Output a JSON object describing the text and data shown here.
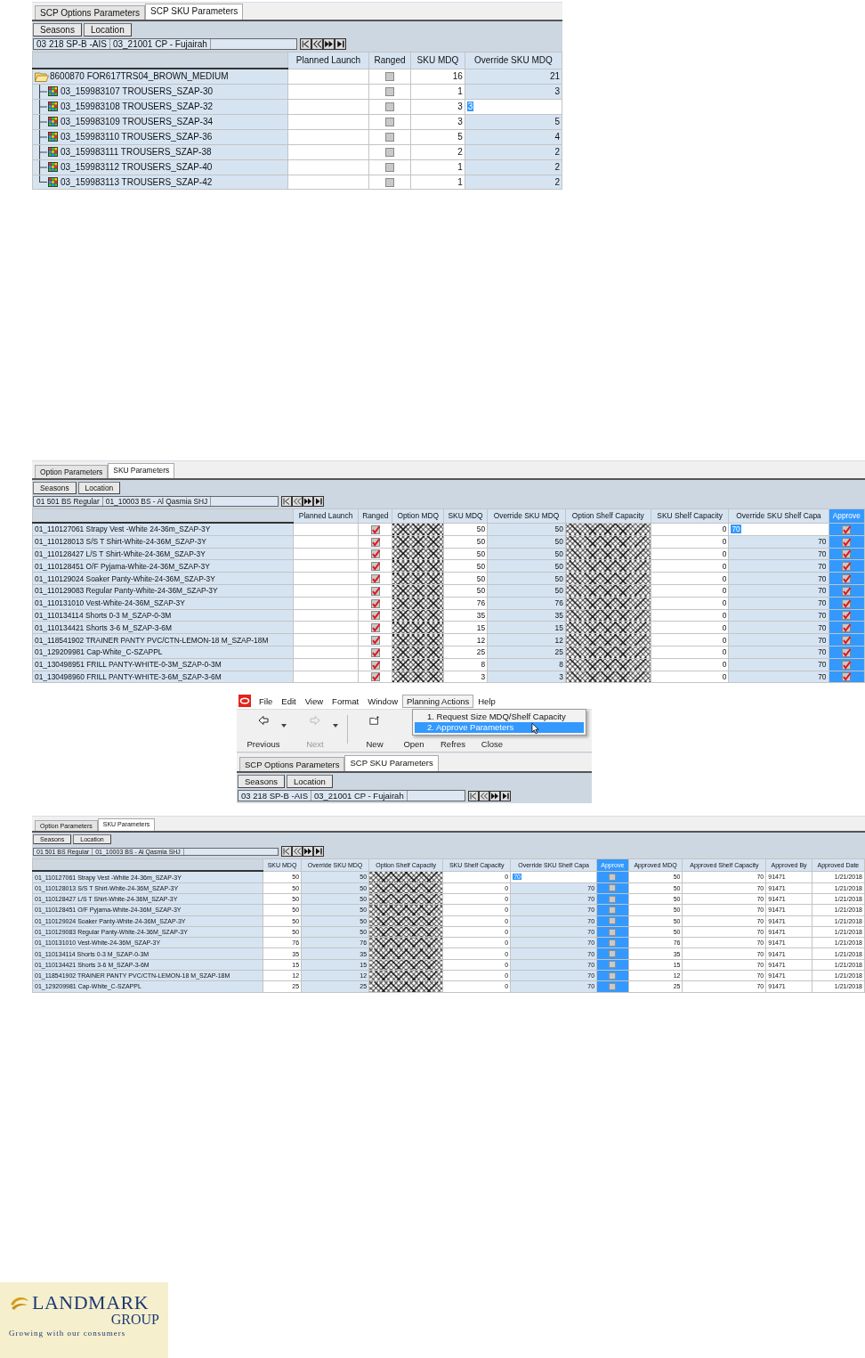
{
  "panels": [
    {
      "kind": "grid",
      "tabs": [
        {
          "label": "SCP Options Parameters",
          "selected": false
        },
        {
          "label": "SCP SKU Parameters",
          "selected": true
        }
      ],
      "buttons": [
        "Seasons",
        "Location"
      ],
      "context": [
        "03  218  SP-B -AIS",
        "03_21001 CP - Fujairah"
      ],
      "columns": [
        {
          "label": "Planned Launch",
          "selected": false
        },
        {
          "label": "Ranged",
          "selected": false
        },
        {
          "label": "SKU MDQ",
          "selected": false
        },
        {
          "label": "Override SKU MDQ",
          "selected": false
        }
      ],
      "rows": [
        {
          "label": "8600870 FOR617TRS04_BROWN_MEDIUM",
          "cells": [
            {
              "kind": "blank"
            },
            {
              "kind": "check",
              "checked": false
            },
            {
              "kind": "num",
              "text": "16"
            },
            {
              "kind": "input",
              "text": "21"
            }
          ],
          "children": [
            {
              "label": "03_159983107 TROUSERS_SZAP-30",
              "cells": [
                {
                  "kind": "blank"
                },
                {
                  "kind": "check",
                  "checked": false
                },
                {
                  "kind": "num",
                  "text": "1"
                },
                {
                  "kind": "input",
                  "text": "3"
                }
              ]
            },
            {
              "label": "03_159983108 TROUSERS_SZAP-32",
              "cells": [
                {
                  "kind": "blank"
                },
                {
                  "kind": "check",
                  "checked": false
                },
                {
                  "kind": "num",
                  "text": "3"
                },
                {
                  "kind": "edit",
                  "text": "3"
                }
              ]
            },
            {
              "label": "03_159983109 TROUSERS_SZAP-34",
              "cells": [
                {
                  "kind": "blank"
                },
                {
                  "kind": "check",
                  "checked": false
                },
                {
                  "kind": "num",
                  "text": "3"
                },
                {
                  "kind": "input",
                  "text": "5"
                }
              ]
            },
            {
              "label": "03_159983110 TROUSERS_SZAP-36",
              "cells": [
                {
                  "kind": "blank"
                },
                {
                  "kind": "check",
                  "checked": false
                },
                {
                  "kind": "num",
                  "text": "5"
                },
                {
                  "kind": "input",
                  "text": "4"
                }
              ]
            },
            {
              "label": "03_159983111 TROUSERS_SZAP-38",
              "cells": [
                {
                  "kind": "blank"
                },
                {
                  "kind": "check",
                  "checked": false
                },
                {
                  "kind": "num",
                  "text": "2"
                },
                {
                  "kind": "input",
                  "text": "2"
                }
              ]
            },
            {
              "label": "03_159983112 TROUSERS_SZAP-40",
              "cells": [
                {
                  "kind": "blank"
                },
                {
                  "kind": "check",
                  "checked": false
                },
                {
                  "kind": "num",
                  "text": "1"
                },
                {
                  "kind": "input",
                  "text": "2"
                }
              ]
            },
            {
              "label": "03_159983113 TROUSERS_SZAP-42",
              "cells": [
                {
                  "kind": "blank"
                },
                {
                  "kind": "check",
                  "checked": false
                },
                {
                  "kind": "num",
                  "text": "1"
                },
                {
                  "kind": "input",
                  "text": "2"
                }
              ]
            }
          ]
        }
      ]
    },
    {
      "kind": "grid",
      "tabs": [
        {
          "label": "Option Parameters",
          "selected": false
        },
        {
          "label": "SKU Parameters",
          "selected": true
        }
      ],
      "buttons": [
        "Seasons",
        "Location"
      ],
      "context": [
        "01  501  BS Regular",
        "01_10003 BS - Al Qasmia SHJ"
      ],
      "columns": [
        {
          "label": "Planned Launch",
          "selected": false
        },
        {
          "label": "Ranged",
          "selected": false
        },
        {
          "label": "Option MDQ",
          "selected": false
        },
        {
          "label": "SKU MDQ",
          "selected": false
        },
        {
          "label": "Override SKU MDQ",
          "selected": false
        },
        {
          "label": "Option Shelf Capacity",
          "selected": false
        },
        {
          "label": "SKU Shelf Capacity",
          "selected": false
        },
        {
          "label": "Override SKU Shelf Capa",
          "selected": false
        },
        {
          "label": "Approve",
          "selected": true
        }
      ],
      "rows": [
        {
          "label": "01_110127061 Strapy Vest -White 24-36m_SZAP-3Y",
          "cells": [
            {
              "kind": "blank"
            },
            {
              "kind": "check",
              "checked": true
            },
            {
              "kind": "hatch"
            },
            {
              "kind": "num",
              "text": "50"
            },
            {
              "kind": "input",
              "text": "50"
            },
            {
              "kind": "hatch"
            },
            {
              "kind": "num",
              "text": "0"
            },
            {
              "kind": "edit",
              "text": "70"
            },
            {
              "kind": "check",
              "checked": true
            }
          ]
        },
        {
          "label": "01_110128013 S/S T Shirt-White-24-36M_SZAP-3Y",
          "cells": [
            {
              "kind": "blank"
            },
            {
              "kind": "check",
              "checked": true
            },
            {
              "kind": "hatch"
            },
            {
              "kind": "num",
              "text": "50"
            },
            {
              "kind": "input",
              "text": "50"
            },
            {
              "kind": "hatch"
            },
            {
              "kind": "num",
              "text": "0"
            },
            {
              "kind": "input",
              "text": "70"
            },
            {
              "kind": "check",
              "checked": true
            }
          ]
        },
        {
          "label": "01_110128427 L/S T Shirt-White-24-36M_SZAP-3Y",
          "cells": [
            {
              "kind": "blank"
            },
            {
              "kind": "check",
              "checked": true
            },
            {
              "kind": "hatch"
            },
            {
              "kind": "num",
              "text": "50"
            },
            {
              "kind": "input",
              "text": "50"
            },
            {
              "kind": "hatch"
            },
            {
              "kind": "num",
              "text": "0"
            },
            {
              "kind": "input",
              "text": "70"
            },
            {
              "kind": "check",
              "checked": true
            }
          ]
        },
        {
          "label": "01_110128451 O/F Pyjama-White-24-36M_SZAP-3Y",
          "cells": [
            {
              "kind": "blank"
            },
            {
              "kind": "check",
              "checked": true
            },
            {
              "kind": "hatch"
            },
            {
              "kind": "num",
              "text": "50"
            },
            {
              "kind": "input",
              "text": "50"
            },
            {
              "kind": "hatch"
            },
            {
              "kind": "num",
              "text": "0"
            },
            {
              "kind": "input",
              "text": "70"
            },
            {
              "kind": "check",
              "checked": true
            }
          ]
        },
        {
          "label": "01_110129024 Soaker Panty-White-24-36M_SZAP-3Y",
          "cells": [
            {
              "kind": "blank"
            },
            {
              "kind": "check",
              "checked": true
            },
            {
              "kind": "hatch"
            },
            {
              "kind": "num",
              "text": "50"
            },
            {
              "kind": "input",
              "text": "50"
            },
            {
              "kind": "hatch"
            },
            {
              "kind": "num",
              "text": "0"
            },
            {
              "kind": "input",
              "text": "70"
            },
            {
              "kind": "check",
              "checked": true
            }
          ]
        },
        {
          "label": "01_110129083 Regular Panty-White-24-36M_SZAP-3Y",
          "cells": [
            {
              "kind": "blank"
            },
            {
              "kind": "check",
              "checked": true
            },
            {
              "kind": "hatch"
            },
            {
              "kind": "num",
              "text": "50"
            },
            {
              "kind": "input",
              "text": "50"
            },
            {
              "kind": "hatch"
            },
            {
              "kind": "num",
              "text": "0"
            },
            {
              "kind": "input",
              "text": "70"
            },
            {
              "kind": "check",
              "checked": true
            }
          ]
        },
        {
          "label": "01_110131010 Vest-White-24-36M_SZAP-3Y",
          "cells": [
            {
              "kind": "blank"
            },
            {
              "kind": "check",
              "checked": true
            },
            {
              "kind": "hatch"
            },
            {
              "kind": "num",
              "text": "76"
            },
            {
              "kind": "input",
              "text": "76"
            },
            {
              "kind": "hatch"
            },
            {
              "kind": "num",
              "text": "0"
            },
            {
              "kind": "input",
              "text": "70"
            },
            {
              "kind": "check",
              "checked": true
            }
          ]
        },
        {
          "label": "01_110134114 Shorts 0-3 M_SZAP-0-3M",
          "cells": [
            {
              "kind": "blank"
            },
            {
              "kind": "check",
              "checked": true
            },
            {
              "kind": "hatch"
            },
            {
              "kind": "num",
              "text": "35"
            },
            {
              "kind": "input",
              "text": "35"
            },
            {
              "kind": "hatch"
            },
            {
              "kind": "num",
              "text": "0"
            },
            {
              "kind": "input",
              "text": "70"
            },
            {
              "kind": "check",
              "checked": true
            }
          ]
        },
        {
          "label": "01_110134421 Shorts 3-6 M_SZAP-3-6M",
          "cells": [
            {
              "kind": "blank"
            },
            {
              "kind": "check",
              "checked": true
            },
            {
              "kind": "hatch"
            },
            {
              "kind": "num",
              "text": "15"
            },
            {
              "kind": "input",
              "text": "15"
            },
            {
              "kind": "hatch"
            },
            {
              "kind": "num",
              "text": "0"
            },
            {
              "kind": "input",
              "text": "70"
            },
            {
              "kind": "check",
              "checked": true
            }
          ]
        },
        {
          "label": "01_118541902 TRAINER PANTY PVC/CTN-LEMON-18 M_SZAP-18M",
          "cells": [
            {
              "kind": "blank"
            },
            {
              "kind": "check",
              "checked": true
            },
            {
              "kind": "hatch"
            },
            {
              "kind": "num",
              "text": "12"
            },
            {
              "kind": "input",
              "text": "12"
            },
            {
              "kind": "hatch"
            },
            {
              "kind": "num",
              "text": "0"
            },
            {
              "kind": "input",
              "text": "70"
            },
            {
              "kind": "check",
              "checked": true
            }
          ]
        },
        {
          "label": "01_129209981 Cap-White_C-SZAPPL",
          "cells": [
            {
              "kind": "blank"
            },
            {
              "kind": "check",
              "checked": true
            },
            {
              "kind": "hatch"
            },
            {
              "kind": "num",
              "text": "25"
            },
            {
              "kind": "input",
              "text": "25"
            },
            {
              "kind": "hatch"
            },
            {
              "kind": "num",
              "text": "0"
            },
            {
              "kind": "input",
              "text": "70"
            },
            {
              "kind": "check",
              "checked": true
            }
          ]
        },
        {
          "label": "01_130498951 FRILL PANTY-WHITE-0-3M_SZAP-0-3M",
          "cells": [
            {
              "kind": "blank"
            },
            {
              "kind": "check",
              "checked": true
            },
            {
              "kind": "hatch"
            },
            {
              "kind": "num",
              "text": "8"
            },
            {
              "kind": "input",
              "text": "8"
            },
            {
              "kind": "hatch"
            },
            {
              "kind": "num",
              "text": "0"
            },
            {
              "kind": "input",
              "text": "70"
            },
            {
              "kind": "check",
              "checked": true
            }
          ]
        },
        {
          "label": "01_130498960 FRILL PANTY-WHITE-3-6M_SZAP-3-6M",
          "cells": [
            {
              "kind": "blank"
            },
            {
              "kind": "check",
              "checked": true
            },
            {
              "kind": "hatch"
            },
            {
              "kind": "num",
              "text": "3"
            },
            {
              "kind": "input",
              "text": "3"
            },
            {
              "kind": "hatch"
            },
            {
              "kind": "num",
              "text": "0"
            },
            {
              "kind": "input",
              "text": "70"
            },
            {
              "kind": "check",
              "checked": true
            }
          ]
        }
      ]
    },
    {
      "kind": "menu_shot",
      "menubar": [
        {
          "label": "File",
          "selected": false
        },
        {
          "label": "Edit",
          "selected": false
        },
        {
          "label": "View",
          "selected": false
        },
        {
          "label": "Format",
          "selected": false
        },
        {
          "label": "Window",
          "selected": false
        },
        {
          "label": "Planning Actions",
          "selected": true
        },
        {
          "label": "Help",
          "selected": false
        }
      ],
      "dropdown": [
        {
          "label": "1. Request Size MDQ/Shelf Capacity",
          "selected": false
        },
        {
          "label": "2. Approve Parameters",
          "selected": true
        }
      ],
      "toolbar": [
        {
          "label": "Previous",
          "disabled": false,
          "dropdown": true
        },
        {
          "label": "Next",
          "disabled": true,
          "dropdown": true
        },
        {
          "label": "New",
          "disabled": false,
          "dropdown": false
        },
        {
          "label": "Open",
          "disabled": false,
          "dropdown": false
        },
        {
          "label": "Refres",
          "disabled": false,
          "dropdown": false
        },
        {
          "label": "Close",
          "disabled": false,
          "dropdown": false
        }
      ],
      "tabs": [
        {
          "label": "SCP Options Parameters",
          "selected": false
        },
        {
          "label": "SCP SKU Parameters",
          "selected": true
        }
      ],
      "buttons": [
        "Seasons",
        "Location"
      ],
      "context": [
        "03  218  SP-B -AIS",
        "03_21001 CP - Fujairah"
      ]
    },
    {
      "kind": "grid",
      "tabs": [
        {
          "label": "Option Parameters",
          "selected": false
        },
        {
          "label": "SKU Parameters",
          "selected": true
        }
      ],
      "buttons": [
        "Seasons",
        "Location"
      ],
      "context": [
        "01  501  BS Regular",
        "01_10003 BS - Al Qasmia SHJ"
      ],
      "columns": [
        {
          "label": "SKU MDQ",
          "selected": false
        },
        {
          "label": "Override SKU MDQ",
          "selected": false
        },
        {
          "label": "Option Shelf Capacity",
          "selected": false
        },
        {
          "label": "SKU Shelf Capacity",
          "selected": false
        },
        {
          "label": "Override SKU Shelf Capa",
          "selected": false
        },
        {
          "label": "Approve",
          "selected": true
        },
        {
          "label": "Approved MDQ",
          "selected": false
        },
        {
          "label": "Approved Shelf Capacity",
          "selected": false
        },
        {
          "label": "Approved By",
          "selected": false
        },
        {
          "label": "Approved Date",
          "selected": false
        }
      ],
      "rows": [
        {
          "label": "01_110127061 Strapy Vest -White 24-36m_SZAP-3Y",
          "cells": [
            {
              "kind": "num",
              "text": "50"
            },
            {
              "kind": "input",
              "text": "50"
            },
            {
              "kind": "hatch"
            },
            {
              "kind": "num",
              "text": "0"
            },
            {
              "kind": "edit",
              "text": "70"
            },
            {
              "kind": "check",
              "checked": false
            },
            {
              "kind": "num",
              "text": "50"
            },
            {
              "kind": "num",
              "text": "70"
            },
            {
              "kind": "text",
              "text": "91471"
            },
            {
              "kind": "num",
              "text": "1/21/2018"
            }
          ]
        },
        {
          "label": "01_110128013 S/S T Shirt-White-24-36M_SZAP-3Y",
          "cells": [
            {
              "kind": "num",
              "text": "50"
            },
            {
              "kind": "input",
              "text": "50"
            },
            {
              "kind": "hatch"
            },
            {
              "kind": "num",
              "text": "0"
            },
            {
              "kind": "input",
              "text": "70"
            },
            {
              "kind": "check",
              "checked": false
            },
            {
              "kind": "num",
              "text": "50"
            },
            {
              "kind": "num",
              "text": "70"
            },
            {
              "kind": "text",
              "text": "91471"
            },
            {
              "kind": "num",
              "text": "1/21/2018"
            }
          ]
        },
        {
          "label": "01_110128427 L/S T Shirt-White-24-36M_SZAP-3Y",
          "cells": [
            {
              "kind": "num",
              "text": "50"
            },
            {
              "kind": "input",
              "text": "50"
            },
            {
              "kind": "hatch"
            },
            {
              "kind": "num",
              "text": "0"
            },
            {
              "kind": "input",
              "text": "70"
            },
            {
              "kind": "check",
              "checked": false
            },
            {
              "kind": "num",
              "text": "50"
            },
            {
              "kind": "num",
              "text": "70"
            },
            {
              "kind": "text",
              "text": "91471"
            },
            {
              "kind": "num",
              "text": "1/21/2018"
            }
          ]
        },
        {
          "label": "01_110128451 O/F Pyjama-White-24-36M_SZAP-3Y",
          "cells": [
            {
              "kind": "num",
              "text": "50"
            },
            {
              "kind": "input",
              "text": "50"
            },
            {
              "kind": "hatch"
            },
            {
              "kind": "num",
              "text": "0"
            },
            {
              "kind": "input",
              "text": "70"
            },
            {
              "kind": "check",
              "checked": false
            },
            {
              "kind": "num",
              "text": "50"
            },
            {
              "kind": "num",
              "text": "70"
            },
            {
              "kind": "text",
              "text": "91471"
            },
            {
              "kind": "num",
              "text": "1/21/2018"
            }
          ]
        },
        {
          "label": "01_110129024 Soaker Panty-White-24-36M_SZAP-3Y",
          "cells": [
            {
              "kind": "num",
              "text": "50"
            },
            {
              "kind": "input",
              "text": "50"
            },
            {
              "kind": "hatch"
            },
            {
              "kind": "num",
              "text": "0"
            },
            {
              "kind": "input",
              "text": "70"
            },
            {
              "kind": "check",
              "checked": false
            },
            {
              "kind": "num",
              "text": "50"
            },
            {
              "kind": "num",
              "text": "70"
            },
            {
              "kind": "text",
              "text": "91471"
            },
            {
              "kind": "num",
              "text": "1/21/2018"
            }
          ]
        },
        {
          "label": "01_110129083 Regular Panty-White-24-36M_SZAP-3Y",
          "cells": [
            {
              "kind": "num",
              "text": "50"
            },
            {
              "kind": "input",
              "text": "50"
            },
            {
              "kind": "hatch"
            },
            {
              "kind": "num",
              "text": "0"
            },
            {
              "kind": "input",
              "text": "70"
            },
            {
              "kind": "check",
              "checked": false
            },
            {
              "kind": "num",
              "text": "50"
            },
            {
              "kind": "num",
              "text": "70"
            },
            {
              "kind": "text",
              "text": "91471"
            },
            {
              "kind": "num",
              "text": "1/21/2018"
            }
          ]
        },
        {
          "label": "01_110131010 Vest-White-24-36M_SZAP-3Y",
          "cells": [
            {
              "kind": "num",
              "text": "76"
            },
            {
              "kind": "input",
              "text": "76"
            },
            {
              "kind": "hatch"
            },
            {
              "kind": "num",
              "text": "0"
            },
            {
              "kind": "input",
              "text": "70"
            },
            {
              "kind": "check",
              "checked": false
            },
            {
              "kind": "num",
              "text": "76"
            },
            {
              "kind": "num",
              "text": "70"
            },
            {
              "kind": "text",
              "text": "91471"
            },
            {
              "kind": "num",
              "text": "1/21/2018"
            }
          ]
        },
        {
          "label": "01_110134114 Shorts 0-3 M_SZAP-0-3M",
          "cells": [
            {
              "kind": "num",
              "text": "35"
            },
            {
              "kind": "input",
              "text": "35"
            },
            {
              "kind": "hatch"
            },
            {
              "kind": "num",
              "text": "0"
            },
            {
              "kind": "input",
              "text": "70"
            },
            {
              "kind": "check",
              "checked": false
            },
            {
              "kind": "num",
              "text": "35"
            },
            {
              "kind": "num",
              "text": "70"
            },
            {
              "kind": "text",
              "text": "91471"
            },
            {
              "kind": "num",
              "text": "1/21/2018"
            }
          ]
        },
        {
          "label": "01_110134421 Shorts 3-6 M_SZAP-3-6M",
          "cells": [
            {
              "kind": "num",
              "text": "15"
            },
            {
              "kind": "input",
              "text": "15"
            },
            {
              "kind": "hatch"
            },
            {
              "kind": "num",
              "text": "0"
            },
            {
              "kind": "input",
              "text": "70"
            },
            {
              "kind": "check",
              "checked": false
            },
            {
              "kind": "num",
              "text": "15"
            },
            {
              "kind": "num",
              "text": "70"
            },
            {
              "kind": "text",
              "text": "91471"
            },
            {
              "kind": "num",
              "text": "1/21/2018"
            }
          ]
        },
        {
          "label": "01_118541902 TRAINER PANTY PVC/CTN-LEMON-18 M_SZAP-18M",
          "cells": [
            {
              "kind": "num",
              "text": "12"
            },
            {
              "kind": "input",
              "text": "12"
            },
            {
              "kind": "hatch"
            },
            {
              "kind": "num",
              "text": "0"
            },
            {
              "kind": "input",
              "text": "70"
            },
            {
              "kind": "check",
              "checked": false
            },
            {
              "kind": "num",
              "text": "12"
            },
            {
              "kind": "num",
              "text": "70"
            },
            {
              "kind": "text",
              "text": "91471"
            },
            {
              "kind": "num",
              "text": "1/21/2018"
            }
          ]
        },
        {
          "label": "01_129209981 Cap-White_C-SZAPPL",
          "cells": [
            {
              "kind": "num",
              "text": "25"
            },
            {
              "kind": "input",
              "text": "25"
            },
            {
              "kind": "hatch"
            },
            {
              "kind": "num",
              "text": "0"
            },
            {
              "kind": "input",
              "text": "70"
            },
            {
              "kind": "check",
              "checked": false
            },
            {
              "kind": "num",
              "text": "25"
            },
            {
              "kind": "num",
              "text": "70"
            },
            {
              "kind": "text",
              "text": "91471"
            },
            {
              "kind": "num",
              "text": "1/21/2018"
            }
          ]
        }
      ]
    }
  ],
  "logo": {
    "name": "LANDMARK",
    "group": "GROUP",
    "tagline": "Growing with our consumers"
  }
}
